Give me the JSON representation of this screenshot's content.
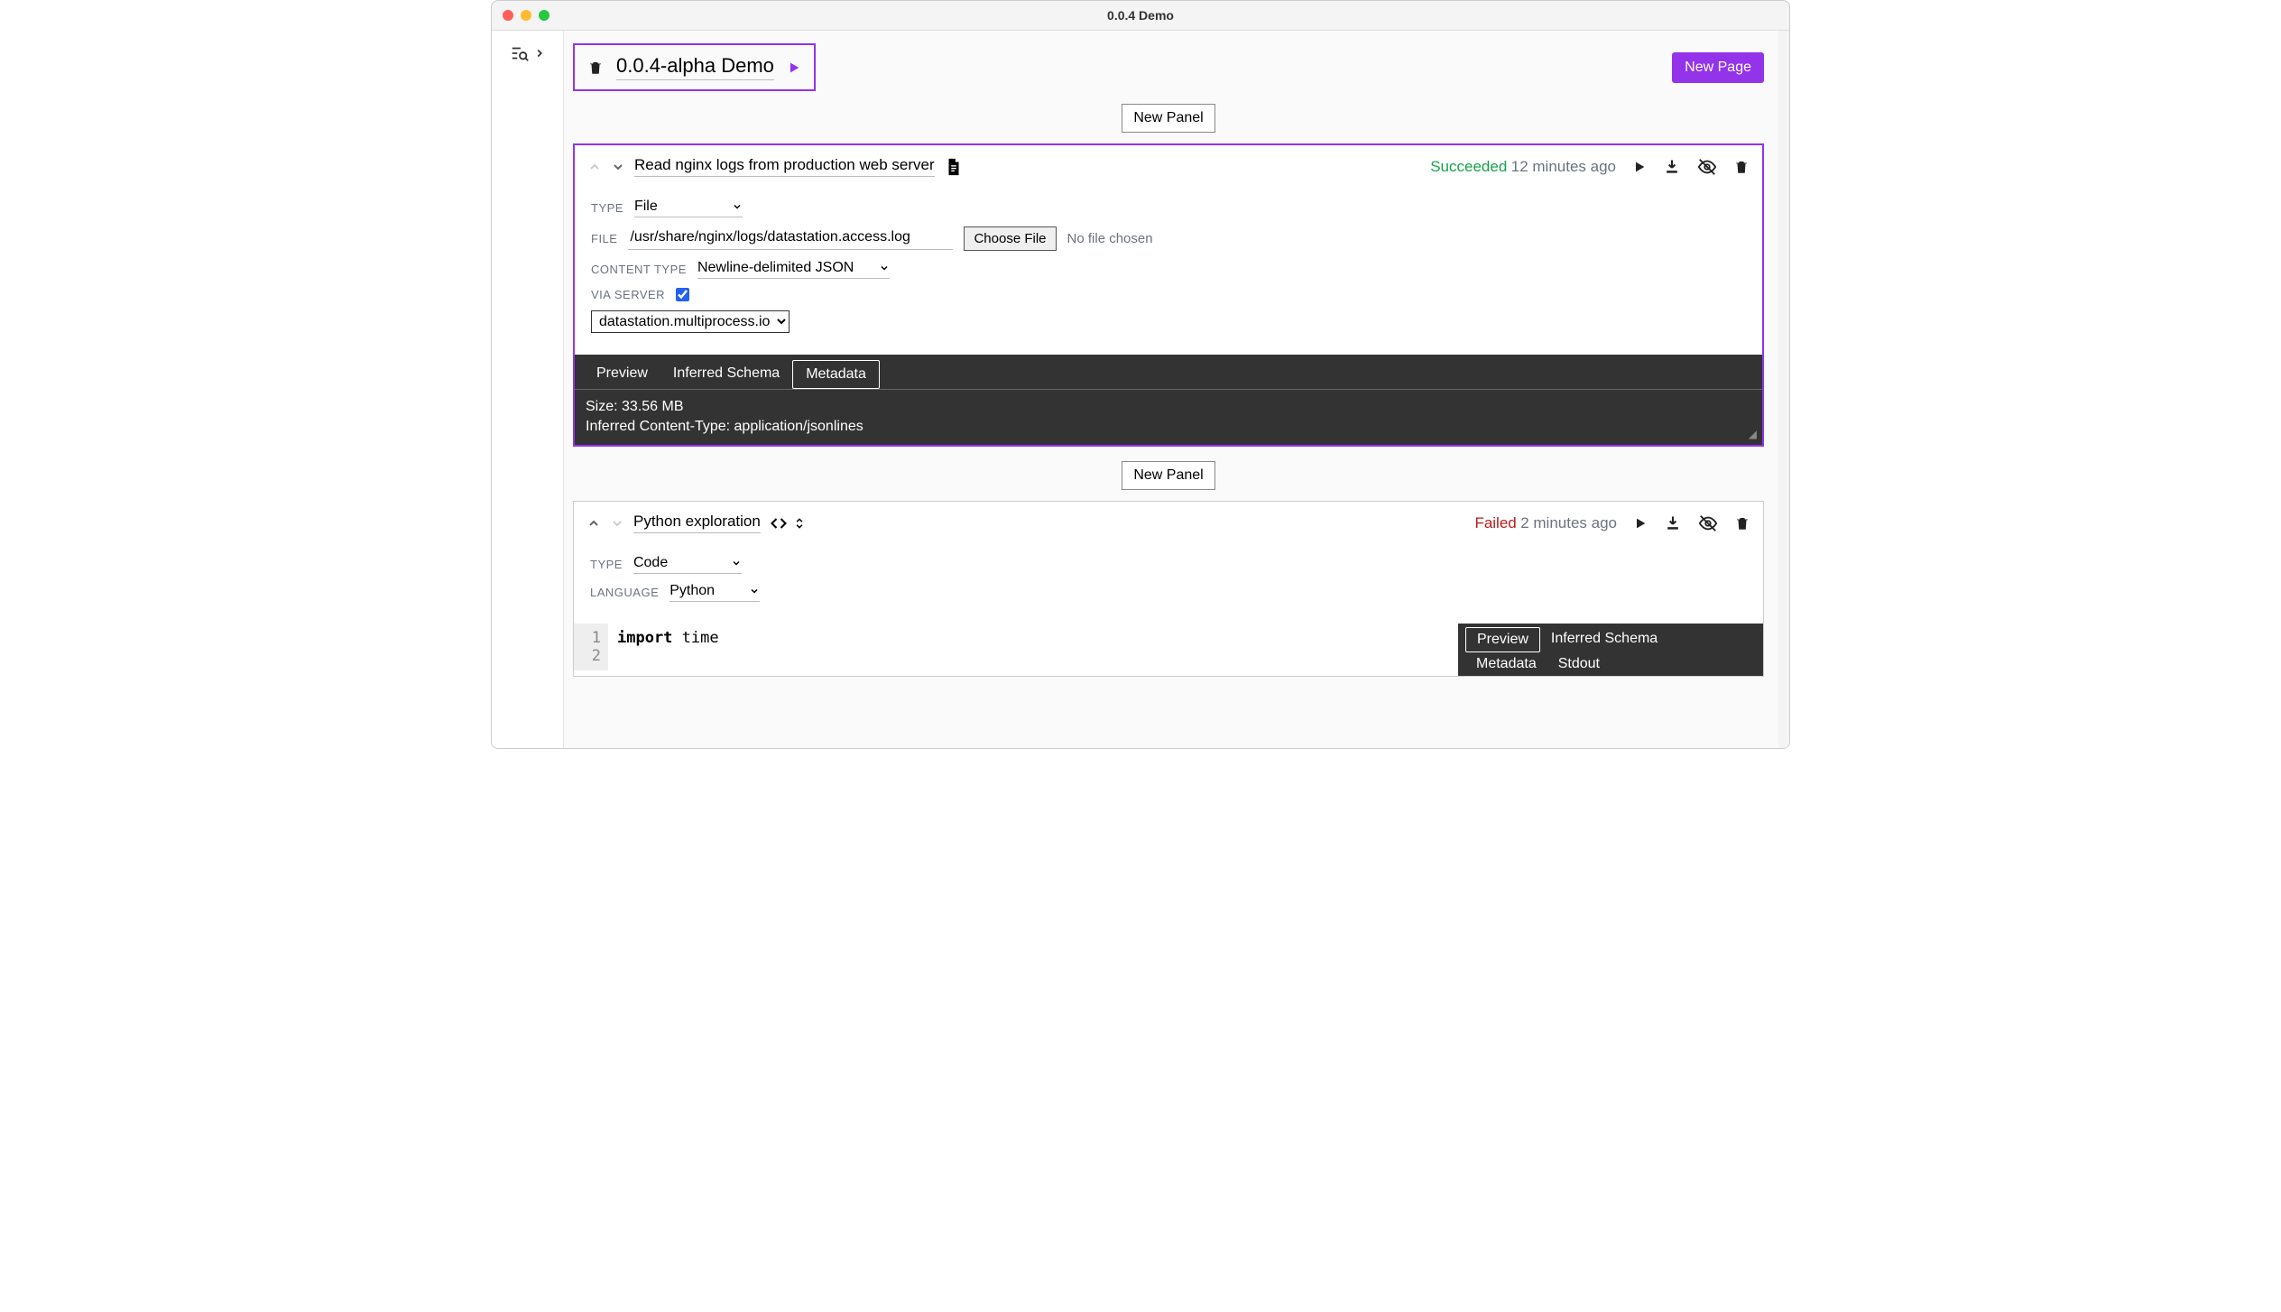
{
  "window": {
    "title": "0.0.4 Demo"
  },
  "page": {
    "name": "0.0.4-alpha Demo",
    "new_page_label": "New Page",
    "new_panel_label": "New Panel"
  },
  "panel1": {
    "title": "Read nginx logs from production web server",
    "status": "Succeeded",
    "time": "12 minutes ago",
    "type_label": "TYPE",
    "type_value": "File",
    "file_label": "FILE",
    "file_value": "/usr/share/nginx/logs/datastation.access.log",
    "choose_file": "Choose File",
    "no_file": "No file chosen",
    "content_type_label": "CONTENT TYPE",
    "content_type_value": "Newline-delimited JSON",
    "via_server_label": "VIA SERVER",
    "server_value": "datastation.multiprocess.io",
    "tabs": {
      "preview": "Preview",
      "schema": "Inferred Schema",
      "metadata": "Metadata"
    },
    "metadata_line1": "Size: 33.56 MB",
    "metadata_line2": "Inferred Content-Type: application/jsonlines"
  },
  "panel2": {
    "title": "Python exploration",
    "status": "Failed",
    "time": "2 minutes ago",
    "type_label": "TYPE",
    "type_value": "Code",
    "language_label": "LANGUAGE",
    "language_value": "Python",
    "code": {
      "line1_kw": "import",
      "line1_rest": " time",
      "lineno1": "1",
      "lineno2": "2"
    },
    "tabs": {
      "preview": "Preview",
      "schema": "Inferred Schema",
      "metadata": "Metadata",
      "stdout": "Stdout"
    }
  }
}
